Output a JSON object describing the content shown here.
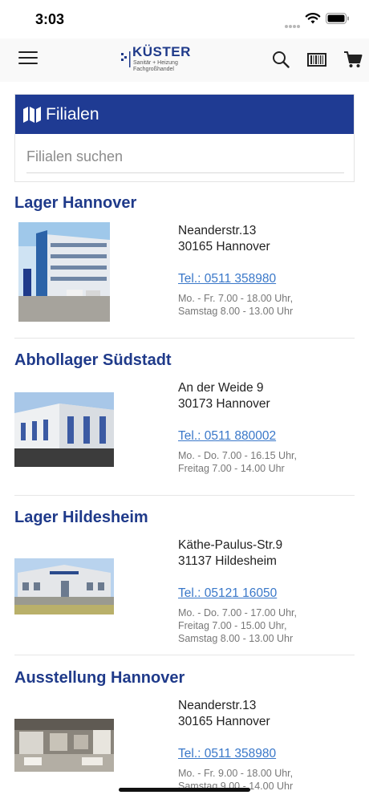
{
  "status": {
    "time": "3:03"
  },
  "header": {
    "logo_word": "KÜSTER",
    "logo_sub_1": "Sanitär + Heizung",
    "logo_sub_2": "Fachgroßhandel"
  },
  "panel": {
    "title": "Filialen",
    "search_placeholder": "Filialen suchen"
  },
  "branches": [
    {
      "name": "Lager Hannover",
      "street": "Neanderstr.13",
      "city": "30165 Hannover",
      "tel": "Tel.: 0511 358980",
      "hours": [
        "Mo. - Fr. 7.00 - 18.00 Uhr,",
        "Samstag 8.00 - 13.00 Uhr"
      ]
    },
    {
      "name": "Abhollager Südstadt",
      "street": "An der Weide 9",
      "city": "30173 Hannover",
      "tel": "Tel.: 0511 880002",
      "hours": [
        "Mo. - Do. 7.00 - 16.15 Uhr,",
        "Freitag 7.00 - 14.00 Uhr"
      ]
    },
    {
      "name": "Lager Hildesheim",
      "street": "Käthe-Paulus-Str.9",
      "city": "31137 Hildesheim",
      "tel": "Tel.: 05121 16050",
      "hours": [
        "Mo. - Do. 7.00 - 17.00 Uhr,",
        "Freitag 7.00 - 15.00 Uhr,",
        "Samstag 8.00 - 13.00 Uhr"
      ]
    },
    {
      "name": "Ausstellung Hannover",
      "street": "Neanderstr.13",
      "city": "30165 Hannover",
      "tel": "Tel.: 0511 358980",
      "hours": [
        "Mo. - Fr. 9.00 - 18.00 Uhr,",
        "Samstag 9.00 - 14.00 Uhr"
      ]
    }
  ],
  "colors": {
    "brand_blue": "#1f3b93",
    "link_blue": "#3a78c9"
  }
}
